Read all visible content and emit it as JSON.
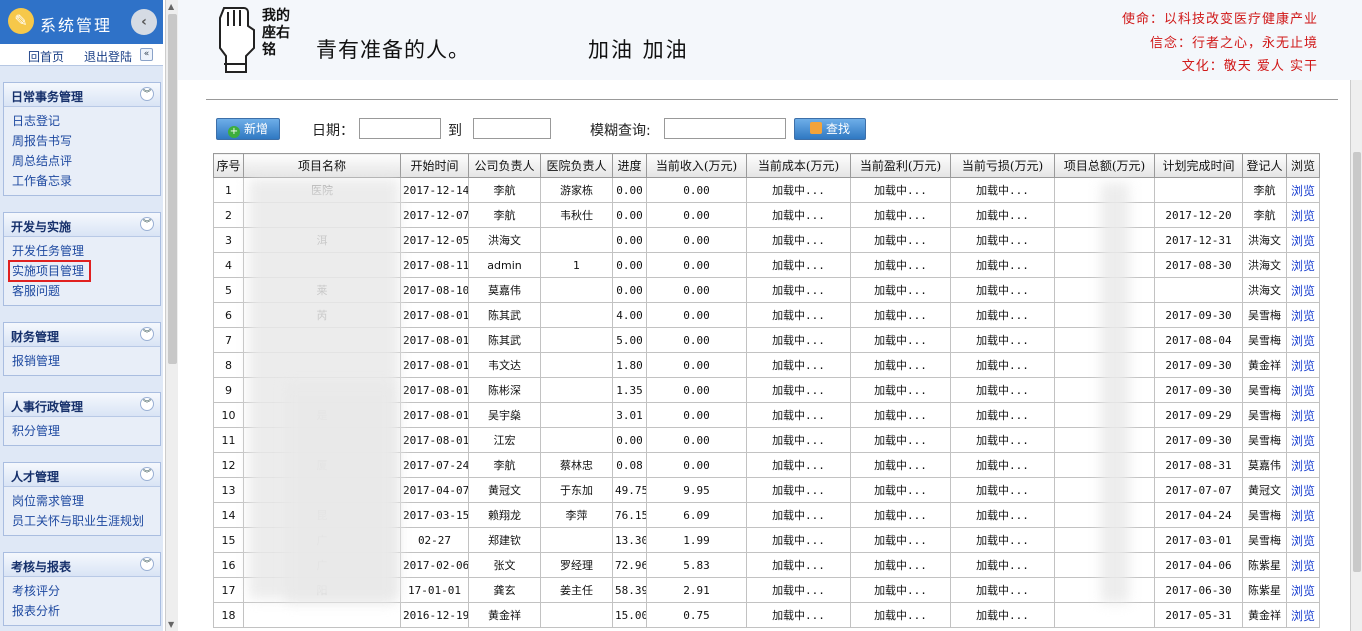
{
  "sidebar": {
    "title": "系统管理",
    "links": {
      "home": "回首页",
      "logout": "退出登陆"
    },
    "groups": [
      {
        "title": "日常事务管理",
        "items": [
          "日志登记",
          "周报告书写",
          "周总结点评",
          "工作备忘录"
        ]
      },
      {
        "title": "开发与实施",
        "items": [
          "开发任务管理",
          "实施项目管理",
          "客服问题"
        ]
      },
      {
        "title": "财务管理",
        "items": [
          "报销管理"
        ]
      },
      {
        "title": "人事行政管理",
        "items": [
          "积分管理"
        ]
      },
      {
        "title": "人才管理",
        "items": [
          "岗位需求管理",
          "员工关怀与职业生涯规划"
        ]
      },
      {
        "title": "考核与报表",
        "items": [
          "考核评分",
          "报表分析"
        ]
      }
    ],
    "active_item": "实施项目管理"
  },
  "banner": {
    "motto_label": "我的座右铭",
    "motto_text": "青有准备的人。",
    "motto_cheer": "加油 加油",
    "slogans": [
      "使命：以科技改变医疗健康产业",
      "信念：行者之心，永无止境",
      "文化：敬天 爱人 实干"
    ]
  },
  "toolbar": {
    "add_label": "新增",
    "date_label": "日期：",
    "to_label": "到",
    "fuzzy_label": "模糊查询:",
    "date_from": "",
    "date_to": "",
    "fuzzy_value": "",
    "search_label": "查找"
  },
  "table": {
    "headers": [
      "序号",
      "项目名称",
      "开始时间",
      "公司负责人",
      "医院负责人",
      "进度",
      "当前收入(万元)",
      "当前成本(万元)",
      "当前盈利(万元)",
      "当前亏损(万元)",
      "项目总额(万元)",
      "计划完成时间",
      "登记人",
      "浏览"
    ],
    "rows": [
      [
        "1",
        "医院",
        "2017-12-14",
        "李航",
        "游家栋",
        "0.00",
        "0.00",
        "加载中...",
        "加载中...",
        "加载中...",
        "",
        "",
        "李航",
        "浏览"
      ],
      [
        "2",
        "",
        "2017-12-07",
        "李航",
        "韦秋仕",
        "0.00",
        "0.00",
        "加载中...",
        "加载中...",
        "加载中...",
        "",
        "2017-12-20",
        "李航",
        "浏览"
      ],
      [
        "3",
        "洱",
        "2017-12-05",
        "洪海文",
        "",
        "0.00",
        "0.00",
        "加载中...",
        "加载中...",
        "加载中...",
        "",
        "2017-12-31",
        "洪海文",
        "浏览"
      ],
      [
        "4",
        "",
        "2017-08-11",
        "admin",
        "1",
        "0.00",
        "0.00",
        "加载中...",
        "加载中...",
        "加载中...",
        "",
        "2017-08-30",
        "洪海文",
        "浏览"
      ],
      [
        "5",
        "莱",
        "2017-08-10",
        "莫嘉伟",
        "",
        "0.00",
        "0.00",
        "加载中...",
        "加载中...",
        "加载中...",
        "",
        "",
        "洪海文",
        "浏览"
      ],
      [
        "6",
        "芮",
        "2017-08-01",
        "陈其武",
        "",
        "4.00",
        "0.00",
        "加载中...",
        "加载中...",
        "加载中...",
        "",
        "2017-09-30",
        "吴雪梅",
        "浏览"
      ],
      [
        "7",
        "",
        "2017-08-01",
        "陈其武",
        "",
        "5.00",
        "0.00",
        "加载中...",
        "加载中...",
        "加载中...",
        "",
        "2017-08-04",
        "吴雪梅",
        "浏览"
      ],
      [
        "8",
        "",
        "2017-08-01",
        "韦文达",
        "",
        "1.80",
        "0.00",
        "加载中...",
        "加载中...",
        "加载中...",
        "",
        "2017-09-30",
        "黄金祥",
        "浏览"
      ],
      [
        "9",
        "",
        "2017-08-01",
        "陈彬深",
        "",
        "1.35",
        "0.00",
        "加载中...",
        "加载中...",
        "加载中...",
        "",
        "2017-09-30",
        "吴雪梅",
        "浏览"
      ],
      [
        "10",
        "是",
        "2017-08-01",
        "吴宇燊",
        "",
        "3.01",
        "0.00",
        "加载中...",
        "加载中...",
        "加载中...",
        "",
        "2017-09-29",
        "吴雪梅",
        "浏览"
      ],
      [
        "11",
        "",
        "2017-08-01",
        "江宏",
        "",
        "0.00",
        "0.00",
        "加载中...",
        "加载中...",
        "加载中...",
        "",
        "2017-09-30",
        "吴雪梅",
        "浏览"
      ],
      [
        "12",
        "厦",
        "2017-07-24",
        "李航",
        "蔡林忠",
        "0.08",
        "0.00",
        "加载中...",
        "加载中...",
        "加载中...",
        "",
        "2017-08-31",
        "莫嘉伟",
        "浏览"
      ],
      [
        "13",
        "",
        "2017-04-07",
        "黄冠文",
        "于东加",
        "49.75",
        "9.95",
        "加载中...",
        "加载中...",
        "加载中...",
        "",
        "2017-07-07",
        "黄冠文",
        "浏览"
      ],
      [
        "14",
        "昆",
        "2017-03-15",
        "赖翔龙",
        "李萍",
        "76.15",
        "6.09",
        "加载中...",
        "加载中...",
        "加载中...",
        "",
        "2017-04-24",
        "吴雪梅",
        "浏览"
      ],
      [
        "15",
        "广",
        "02-27",
        "郑建钦",
        "",
        "13.30",
        "1.99",
        "加载中...",
        "加载中...",
        "加载中...",
        "",
        "2017-03-01",
        "吴雪梅",
        "浏览"
      ],
      [
        "16",
        "广",
        "2017-02-06",
        "张文",
        "罗经理",
        "72.96",
        "5.83",
        "加载中...",
        "加载中...",
        "加载中...",
        "",
        "2017-04-06",
        "陈紫星",
        "浏览"
      ],
      [
        "17",
        "阳",
        "17-01-01",
        "龚玄",
        "姜主任",
        "58.39",
        "2.91",
        "加载中...",
        "加载中...",
        "加载中...",
        "",
        "2017-06-30",
        "陈紫星",
        "浏览"
      ],
      [
        "18",
        "",
        "2016-12-19",
        "黄金祥",
        "",
        "15.00",
        "0.75",
        "加载中...",
        "加载中...",
        "加载中...",
        "",
        "2017-05-31",
        "黄金祥",
        "浏览"
      ]
    ]
  }
}
